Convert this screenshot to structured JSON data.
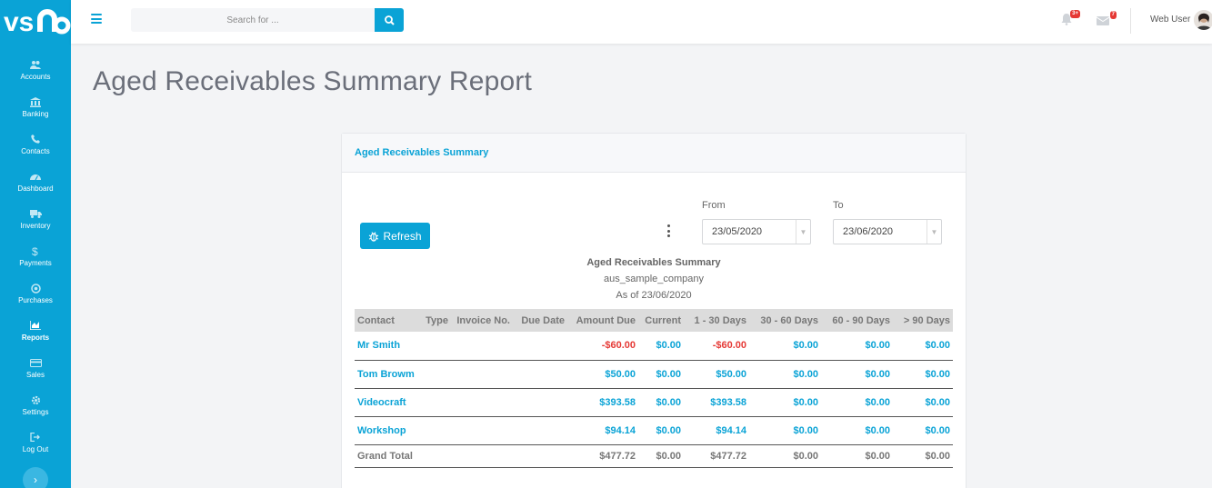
{
  "brand": {
    "logo_text": "vsn"
  },
  "sidebar": {
    "items": [
      {
        "label": "Accounts",
        "icon": "users-icon"
      },
      {
        "label": "Banking",
        "icon": "bank-icon"
      },
      {
        "label": "Contacts",
        "icon": "phone-icon"
      },
      {
        "label": "Dashboard",
        "icon": "dashboard-icon"
      },
      {
        "label": "Inventory",
        "icon": "truck-icon"
      },
      {
        "label": "Payments",
        "icon": "dollar-icon"
      },
      {
        "label": "Purchases",
        "icon": "target-icon"
      },
      {
        "label": "Reports",
        "icon": "chart-icon",
        "active": true
      },
      {
        "label": "Sales",
        "icon": "card-icon"
      },
      {
        "label": "Settings",
        "icon": "gear-icon"
      },
      {
        "label": "Log Out",
        "icon": "logout-icon"
      }
    ],
    "expand_icon": "chevron-right-icon"
  },
  "topbar": {
    "search_placeholder": "Search for ...",
    "notifications_badge": "3+",
    "messages_badge": "7",
    "user_name": "Web User"
  },
  "page": {
    "title": "Aged Receivables Summary Report"
  },
  "card": {
    "header": "Aged Receivables Summary",
    "refresh_label": "Refresh",
    "from_label": "From",
    "from_value": "23/05/2020",
    "to_label": "To",
    "to_value": "23/06/2020"
  },
  "report": {
    "title": "Aged Receivables Summary",
    "company": "aus_sample_company",
    "as_of": "As of 23/06/2020",
    "columns": [
      "Contact",
      "Type",
      "Invoice No.",
      "Due Date",
      "Amount Due",
      "Current",
      "1 - 30 Days",
      "30 - 60 Days",
      "60 - 90 Days",
      "> 90 Days"
    ],
    "rows": [
      {
        "contact": "Mr Smith",
        "type": "",
        "invoice": "",
        "due": "",
        "amount": "-$60.00",
        "current": "$0.00",
        "d1_30": "-$60.00",
        "d30_60": "$0.00",
        "d60_90": "$0.00",
        "d90": "$0.00"
      },
      {
        "contact": "Tom Browm",
        "type": "",
        "invoice": "",
        "due": "",
        "amount": "$50.00",
        "current": "$0.00",
        "d1_30": "$50.00",
        "d30_60": "$0.00",
        "d60_90": "$0.00",
        "d90": "$0.00"
      },
      {
        "contact": "Videocraft",
        "type": "",
        "invoice": "",
        "due": "",
        "amount": "$393.58",
        "current": "$0.00",
        "d1_30": "$393.58",
        "d30_60": "$0.00",
        "d60_90": "$0.00",
        "d90": "$0.00"
      },
      {
        "contact": "Workshop",
        "type": "",
        "invoice": "",
        "due": "",
        "amount": "$94.14",
        "current": "$0.00",
        "d1_30": "$94.14",
        "d30_60": "$0.00",
        "d60_90": "$0.00",
        "d90": "$0.00"
      }
    ],
    "total": {
      "label": "Grand Total",
      "amount": "$477.72",
      "current": "$0.00",
      "d1_30": "$477.72",
      "d30_60": "$0.00",
      "d60_90": "$0.00",
      "d90": "$0.00"
    }
  },
  "colors": {
    "accent": "#0aa3d6",
    "negative": "#e53935"
  }
}
